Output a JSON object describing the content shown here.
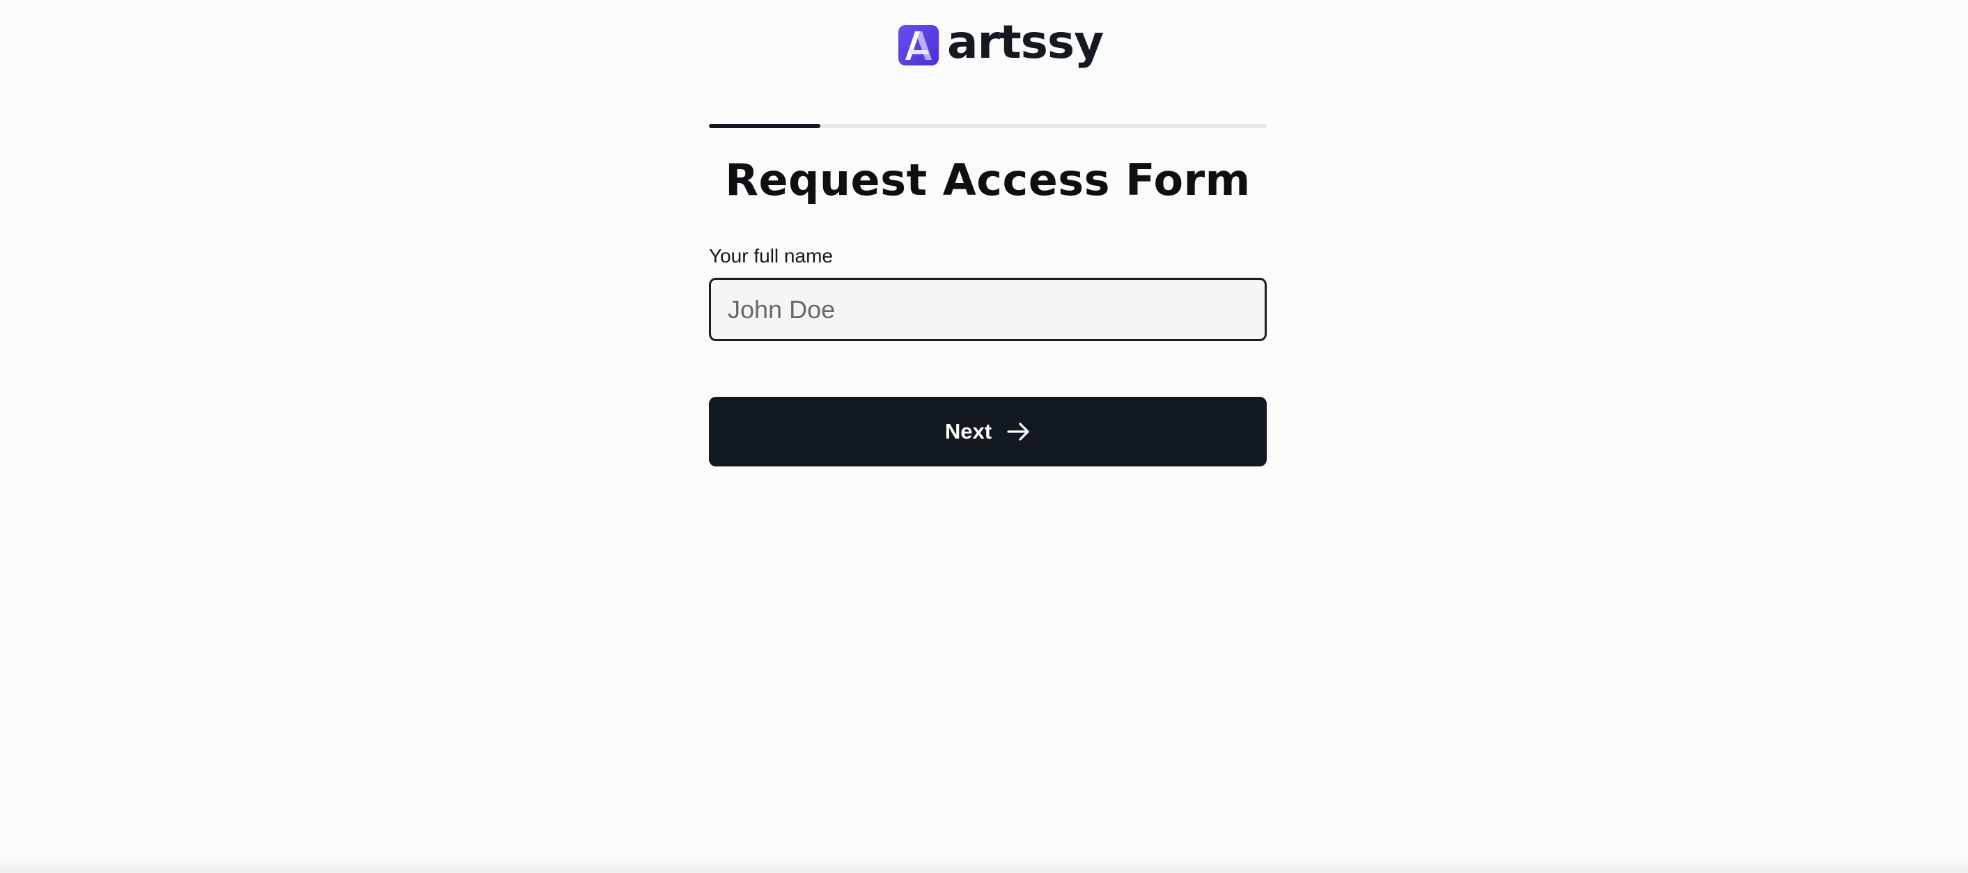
{
  "brand": {
    "name": "artssy",
    "logo_icon": "artssy-a-logo-icon",
    "accent_color": "#5a3fe0"
  },
  "progress": {
    "fraction": 0.2
  },
  "form": {
    "title": "Request Access Form",
    "name_field": {
      "label": "Your full name",
      "value": "",
      "placeholder": "John Doe"
    },
    "next_button": {
      "label": "Next",
      "icon": "arrow-right-icon"
    }
  },
  "colors": {
    "background": "#fbfbfb",
    "primary_dark": "#131920"
  }
}
